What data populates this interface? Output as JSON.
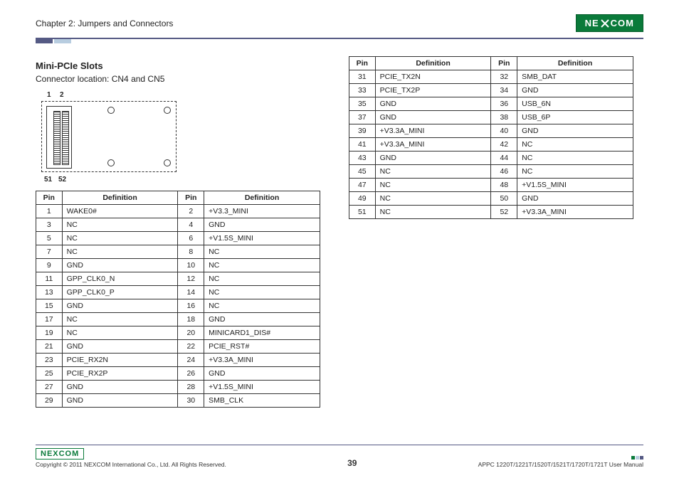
{
  "header": {
    "chapter": "Chapter 2: Jumpers and Connectors",
    "brand": "NEXCOM"
  },
  "section": {
    "title": "Mini-PCIe Slots",
    "subtitle": "Connector location: CN4 and CN5"
  },
  "diagram": {
    "p1": "1",
    "p2": "2",
    "p51": "51",
    "p52": "52"
  },
  "cols": {
    "pin": "Pin",
    "def": "Definition"
  },
  "left_rows": [
    {
      "p1": "1",
      "d1": "WAKE0#",
      "p2": "2",
      "d2": "+V3.3_MINI"
    },
    {
      "p1": "3",
      "d1": "NC",
      "p2": "4",
      "d2": "GND"
    },
    {
      "p1": "5",
      "d1": "NC",
      "p2": "6",
      "d2": "+V1.5S_MINI"
    },
    {
      "p1": "7",
      "d1": "NC",
      "p2": "8",
      "d2": "NC"
    },
    {
      "p1": "9",
      "d1": "GND",
      "p2": "10",
      "d2": "NC"
    },
    {
      "p1": "11",
      "d1": "GPP_CLK0_N",
      "p2": "12",
      "d2": "NC"
    },
    {
      "p1": "13",
      "d1": "GPP_CLK0_P",
      "p2": "14",
      "d2": "NC"
    },
    {
      "p1": "15",
      "d1": "GND",
      "p2": "16",
      "d2": "NC"
    },
    {
      "p1": "17",
      "d1": "NC",
      "p2": "18",
      "d2": "GND"
    },
    {
      "p1": "19",
      "d1": "NC",
      "p2": "20",
      "d2": "MINICARD1_DIS#"
    },
    {
      "p1": "21",
      "d1": "GND",
      "p2": "22",
      "d2": "PCIE_RST#"
    },
    {
      "p1": "23",
      "d1": "PCIE_RX2N",
      "p2": "24",
      "d2": "+V3.3A_MINI"
    },
    {
      "p1": "25",
      "d1": "PCIE_RX2P",
      "p2": "26",
      "d2": "GND"
    },
    {
      "p1": "27",
      "d1": "GND",
      "p2": "28",
      "d2": "+V1.5S_MINI"
    },
    {
      "p1": "29",
      "d1": "GND",
      "p2": "30",
      "d2": "SMB_CLK"
    }
  ],
  "right_rows": [
    {
      "p1": "31",
      "d1": "PCIE_TX2N",
      "p2": "32",
      "d2": "SMB_DAT"
    },
    {
      "p1": "33",
      "d1": "PCIE_TX2P",
      "p2": "34",
      "d2": "GND"
    },
    {
      "p1": "35",
      "d1": "GND",
      "p2": "36",
      "d2": "USB_6N"
    },
    {
      "p1": "37",
      "d1": "GND",
      "p2": "38",
      "d2": "USB_6P"
    },
    {
      "p1": "39",
      "d1": "+V3.3A_MINI",
      "p2": "40",
      "d2": "GND"
    },
    {
      "p1": "41",
      "d1": "+V3.3A_MINI",
      "p2": "42",
      "d2": "NC"
    },
    {
      "p1": "43",
      "d1": "GND",
      "p2": "44",
      "d2": "NC"
    },
    {
      "p1": "45",
      "d1": "NC",
      "p2": "46",
      "d2": "NC"
    },
    {
      "p1": "47",
      "d1": "NC",
      "p2": "48",
      "d2": "+V1.5S_MINI"
    },
    {
      "p1": "49",
      "d1": "NC",
      "p2": "50",
      "d2": "GND"
    },
    {
      "p1": "51",
      "d1": "NC",
      "p2": "52",
      "d2": "+V3.3A_MINI"
    }
  ],
  "footer": {
    "brand": "NEXCOM",
    "copyright": "Copyright © 2011 NEXCOM International Co., Ltd. All Rights Reserved.",
    "page": "39",
    "doc": "APPC 1220T/1221T/1520T/1521T/1720T/1721T User Manual"
  }
}
